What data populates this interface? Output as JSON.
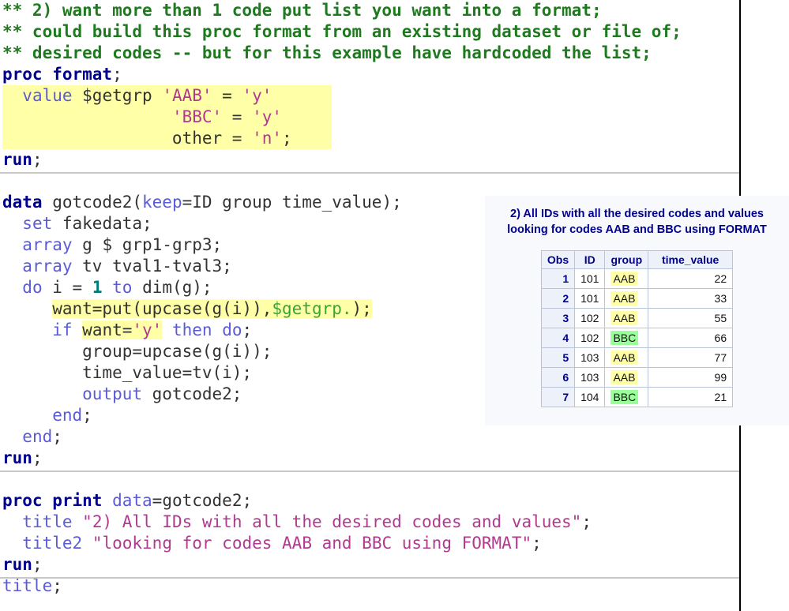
{
  "editor": {
    "lines": [
      {
        "id": "comment-1",
        "indent": 0,
        "segments": [
          {
            "t": "** 2) want more than 1 code put list you want into a format;",
            "c": "c-comment"
          }
        ]
      },
      {
        "id": "comment-2",
        "indent": 0,
        "segments": [
          {
            "t": "** could build this proc format from an existing dataset or file of;",
            "c": "c-comment"
          }
        ]
      },
      {
        "id": "comment-3",
        "indent": 0,
        "segments": [
          {
            "t": "** desired codes -- but for this example have hardcoded the list;",
            "c": "c-comment"
          }
        ]
      },
      {
        "id": "proc-format",
        "indent": 0,
        "segments": [
          {
            "t": "proc format",
            "c": "c-key"
          },
          {
            "t": ";",
            "c": "c-plain"
          }
        ]
      },
      {
        "id": "value-line-1",
        "indent": 0,
        "hl": true,
        "segments": [
          {
            "t": "  ",
            "c": "c-plain"
          },
          {
            "t": "value",
            "c": "c-kw"
          },
          {
            "t": " $getgrp ",
            "c": "c-plain"
          },
          {
            "t": "'AAB'",
            "c": "c-str"
          },
          {
            "t": " = ",
            "c": "c-plain"
          },
          {
            "t": "'y'",
            "c": "c-str"
          }
        ]
      },
      {
        "id": "value-line-2",
        "indent": 0,
        "hl": true,
        "segments": [
          {
            "t": "                 ",
            "c": "c-plain"
          },
          {
            "t": "'BBC'",
            "c": "c-str"
          },
          {
            "t": " = ",
            "c": "c-plain"
          },
          {
            "t": "'y'",
            "c": "c-str"
          }
        ]
      },
      {
        "id": "value-line-3",
        "indent": 0,
        "hl": true,
        "segments": [
          {
            "t": "                 other = ",
            "c": "c-plain"
          },
          {
            "t": "'n'",
            "c": "c-str"
          },
          {
            "t": ";",
            "c": "c-plain"
          }
        ]
      },
      {
        "id": "run-1",
        "indent": 0,
        "segments": [
          {
            "t": "run",
            "c": "c-key"
          },
          {
            "t": ";",
            "c": "c-plain"
          }
        ]
      },
      {
        "id": "blank-1",
        "indent": 0,
        "segments": [
          {
            "t": " ",
            "c": "c-plain"
          }
        ]
      },
      {
        "id": "data-step",
        "indent": 0,
        "segments": [
          {
            "t": "data",
            "c": "c-key"
          },
          {
            "t": " gotcode2(",
            "c": "c-plain"
          },
          {
            "t": "keep",
            "c": "c-kw"
          },
          {
            "t": "=ID group time_value);",
            "c": "c-plain"
          }
        ]
      },
      {
        "id": "set-line",
        "indent": 0,
        "segments": [
          {
            "t": "  ",
            "c": "c-plain"
          },
          {
            "t": "set",
            "c": "c-kw"
          },
          {
            "t": " fakedata;",
            "c": "c-plain"
          }
        ]
      },
      {
        "id": "array-g",
        "indent": 0,
        "segments": [
          {
            "t": "  ",
            "c": "c-plain"
          },
          {
            "t": "array",
            "c": "c-kw"
          },
          {
            "t": " g $ grp1-grp3;",
            "c": "c-plain"
          }
        ]
      },
      {
        "id": "array-tv",
        "indent": 0,
        "segments": [
          {
            "t": "  ",
            "c": "c-plain"
          },
          {
            "t": "array",
            "c": "c-kw"
          },
          {
            "t": " tv tval1-tval3;",
            "c": "c-plain"
          }
        ]
      },
      {
        "id": "do-loop",
        "indent": 0,
        "segments": [
          {
            "t": "  ",
            "c": "c-plain"
          },
          {
            "t": "do",
            "c": "c-kw"
          },
          {
            "t": " i = ",
            "c": "c-plain"
          },
          {
            "t": "1",
            "c": "c-num"
          },
          {
            "t": " ",
            "c": "c-plain"
          },
          {
            "t": "to",
            "c": "c-kw"
          },
          {
            "t": " dim(g);",
            "c": "c-plain"
          }
        ]
      },
      {
        "id": "want-put",
        "indent": 0,
        "segments": [
          {
            "t": "     ",
            "c": "c-plain"
          },
          {
            "t": "want=put(upcase(g(i)),",
            "c": "c-plain",
            "hl": true
          },
          {
            "t": "$getgrp.",
            "c": "c-fmt",
            "hl": true
          },
          {
            "t": ");",
            "c": "c-plain",
            "hl": true
          }
        ]
      },
      {
        "id": "if-want",
        "indent": 0,
        "segments": [
          {
            "t": "     ",
            "c": "c-plain"
          },
          {
            "t": "if",
            "c": "c-kw"
          },
          {
            "t": " ",
            "c": "c-plain"
          },
          {
            "t": "want=",
            "c": "c-plain",
            "hl": true
          },
          {
            "t": "'y'",
            "c": "c-str",
            "hl": true
          },
          {
            "t": " ",
            "c": "c-plain"
          },
          {
            "t": "then",
            "c": "c-kw"
          },
          {
            "t": " ",
            "c": "c-plain"
          },
          {
            "t": "do",
            "c": "c-kw"
          },
          {
            "t": ";",
            "c": "c-plain"
          }
        ]
      },
      {
        "id": "group-assign",
        "indent": 0,
        "segments": [
          {
            "t": "        group=upcase(g(i));",
            "c": "c-plain"
          }
        ]
      },
      {
        "id": "timevalue-assign",
        "indent": 0,
        "segments": [
          {
            "t": "        time_value=tv(i);",
            "c": "c-plain"
          }
        ]
      },
      {
        "id": "output-line",
        "indent": 0,
        "segments": [
          {
            "t": "        ",
            "c": "c-plain"
          },
          {
            "t": "output",
            "c": "c-kw"
          },
          {
            "t": " gotcode2;",
            "c": "c-plain"
          }
        ]
      },
      {
        "id": "end-inner",
        "indent": 0,
        "segments": [
          {
            "t": "     ",
            "c": "c-plain"
          },
          {
            "t": "end",
            "c": "c-kw"
          },
          {
            "t": ";",
            "c": "c-plain"
          }
        ]
      },
      {
        "id": "end-outer",
        "indent": 0,
        "segments": [
          {
            "t": "  ",
            "c": "c-plain"
          },
          {
            "t": "end",
            "c": "c-kw"
          },
          {
            "t": ";",
            "c": "c-plain"
          }
        ]
      },
      {
        "id": "run-2",
        "indent": 0,
        "segments": [
          {
            "t": "run",
            "c": "c-key"
          },
          {
            "t": ";",
            "c": "c-plain"
          }
        ]
      },
      {
        "id": "blank-2",
        "indent": 0,
        "segments": [
          {
            "t": " ",
            "c": "c-plain"
          }
        ]
      },
      {
        "id": "proc-print",
        "indent": 0,
        "segments": [
          {
            "t": "proc print",
            "c": "c-key"
          },
          {
            "t": " ",
            "c": "c-plain"
          },
          {
            "t": "data",
            "c": "c-kw"
          },
          {
            "t": "=gotcode2;",
            "c": "c-plain"
          }
        ]
      },
      {
        "id": "title-1",
        "indent": 0,
        "segments": [
          {
            "t": "  ",
            "c": "c-plain"
          },
          {
            "t": "title",
            "c": "c-kw"
          },
          {
            "t": " ",
            "c": "c-plain"
          },
          {
            "t": "\"2) All IDs with all the desired codes and values\"",
            "c": "c-str"
          },
          {
            "t": ";",
            "c": "c-plain"
          }
        ]
      },
      {
        "id": "title-2",
        "indent": 0,
        "segments": [
          {
            "t": "  ",
            "c": "c-plain"
          },
          {
            "t": "title2",
            "c": "c-kw"
          },
          {
            "t": " ",
            "c": "c-plain"
          },
          {
            "t": "\"looking for codes AAB and BBC using FORMAT\"",
            "c": "c-str"
          },
          {
            "t": ";",
            "c": "c-plain"
          }
        ]
      },
      {
        "id": "run-3",
        "indent": 0,
        "segments": [
          {
            "t": "run",
            "c": "c-key"
          },
          {
            "t": ";",
            "c": "c-plain"
          }
        ]
      },
      {
        "id": "title-clear",
        "indent": 0,
        "segments": [
          {
            "t": "title",
            "c": "c-kw"
          },
          {
            "t": ";",
            "c": "c-plain"
          }
        ]
      }
    ],
    "separators_after_line_index": [
      7,
      21,
      26
    ]
  },
  "overlay": {
    "title1": "2) All IDs with all the desired codes and values",
    "title2": "looking for codes AAB and BBC using FORMAT",
    "table": {
      "headers": [
        "Obs",
        "ID",
        "group",
        "time_value"
      ],
      "rows": [
        {
          "obs": "1",
          "id": "101",
          "group": "AAB",
          "time_value": "22",
          "group_hl": "yellow"
        },
        {
          "obs": "2",
          "id": "101",
          "group": "AAB",
          "time_value": "33",
          "group_hl": "yellow"
        },
        {
          "obs": "3",
          "id": "102",
          "group": "AAB",
          "time_value": "55",
          "group_hl": "yellow"
        },
        {
          "obs": "4",
          "id": "102",
          "group": "BBC",
          "time_value": "66",
          "group_hl": "green"
        },
        {
          "obs": "5",
          "id": "103",
          "group": "AAB",
          "time_value": "77",
          "group_hl": "yellow"
        },
        {
          "obs": "6",
          "id": "103",
          "group": "AAB",
          "time_value": "99",
          "group_hl": "yellow"
        },
        {
          "obs": "7",
          "id": "104",
          "group": "BBC",
          "time_value": "21",
          "group_hl": "green"
        }
      ]
    }
  },
  "colors": {
    "comment": "#1f7a1f",
    "keyword_bold": "#00008f",
    "keyword": "#5b5bd6",
    "string": "#b03a8f",
    "number": "#007a7a",
    "format_ref": "#3aa33a",
    "highlight_yellow": "#ffffa8",
    "cell_yellow": "#ffffa8",
    "cell_green": "#99ff99",
    "overlay_bg": "#f7f9fd"
  }
}
